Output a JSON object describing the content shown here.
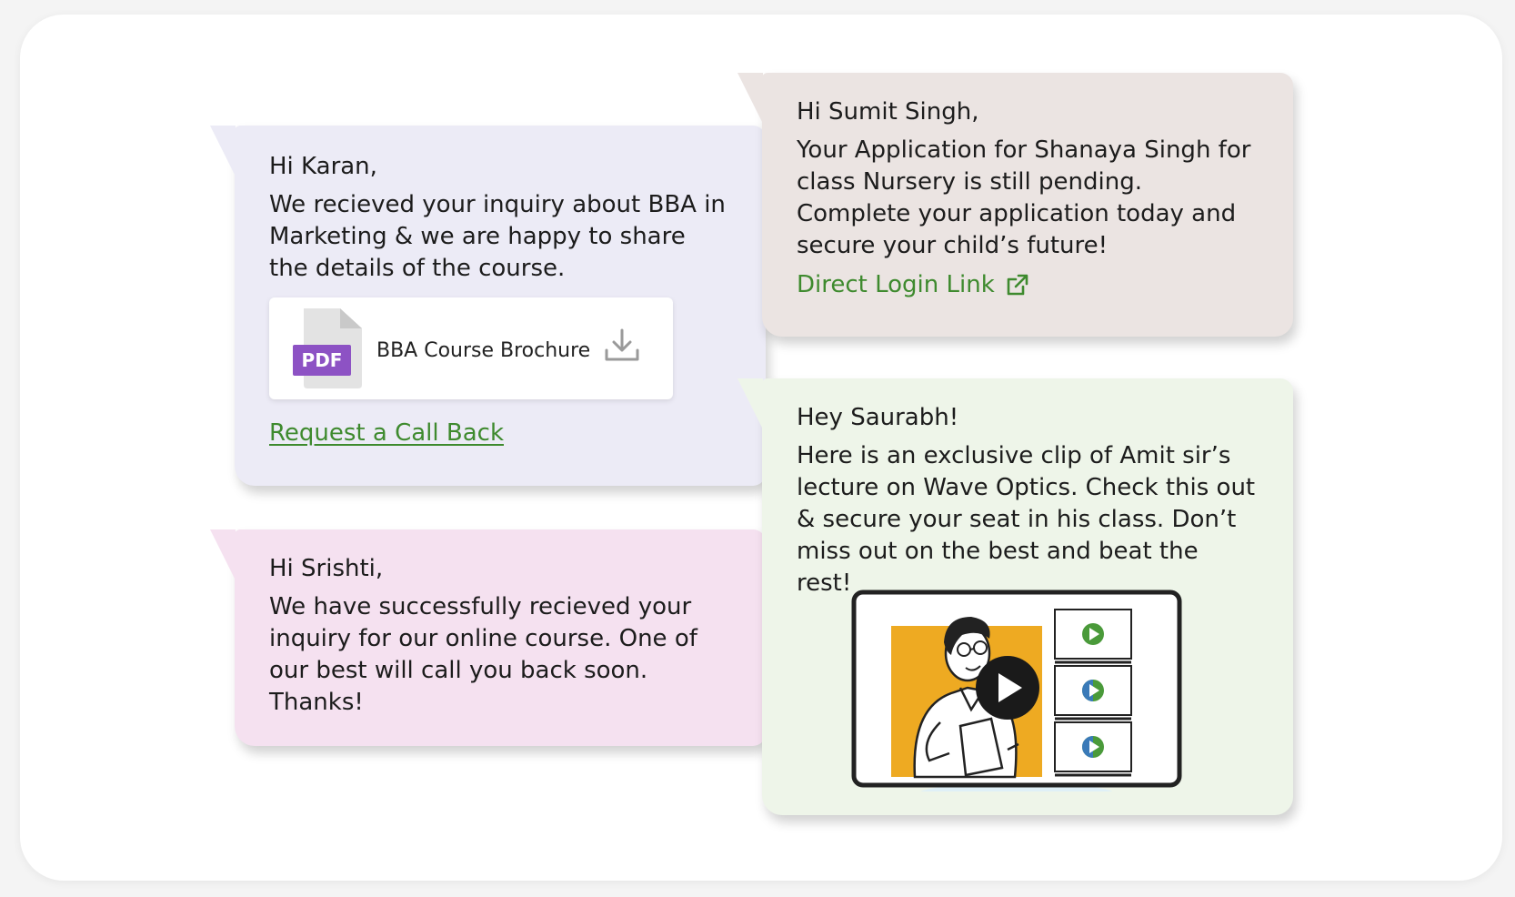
{
  "inquiry_message": {
    "greeting": "Hi Karan,",
    "body": "We recieved your  inquiry  about BBA in Marketing & we are happy to share the details of the course.",
    "attachment": {
      "badge": "PDF",
      "name": "BBA Course Brochure",
      "icon": "download-icon"
    },
    "link": "Request a Call Back"
  },
  "application_message": {
    "greeting": "Hi Sumit Singh,",
    "body": "Your Application for Shanaya Singh for class Nursery is still pending. Complete your application today and secure your child’s future!",
    "link": "Direct Login Link",
    "link_icon": "external-link-icon"
  },
  "callback_message": {
    "greeting": "Hi Srishti,",
    "body": "We have successfully recieved your  inquiry  for our online course. One of our best will call you back soon. Thanks!"
  },
  "video_message": {
    "greeting": "Hey Saurabh!",
    "body": "Here is an exclusive clip of Amit sir’s lecture on Wave Optics. Check this out & secure your seat in his class. Don’t miss out on the best and beat the rest!",
    "media": {
      "icon": "play-icon",
      "playlist_items": 3
    }
  },
  "colors": {
    "link_green": "#3e8a2e",
    "pdf_purple": "#8d52c4",
    "video_bg": "#eeaa22",
    "bubble_lavender": "#ecebf6",
    "bubble_beige": "#ebe4e2",
    "bubble_pink": "#f5e1f0",
    "bubble_green": "#eef5e9"
  }
}
